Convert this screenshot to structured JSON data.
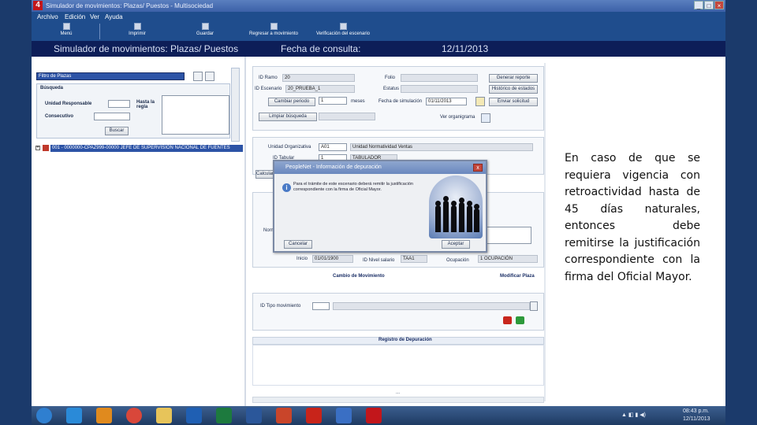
{
  "window": {
    "title": "Simulador de movimientos: Plazas/ Puestos - Multisociedad",
    "logo": "4"
  },
  "menu": [
    "Archivo",
    "Edición",
    "Ver",
    "Ayuda"
  ],
  "toolbar": [
    {
      "label": "Menú",
      "icon": "menu-icon"
    },
    {
      "label": "Imprimir",
      "icon": "print-icon"
    },
    {
      "label": "Guardar",
      "icon": "save-icon"
    },
    {
      "label": "Regresar a movimiento",
      "icon": "back-icon"
    },
    {
      "label": "Verificación del escenario",
      "icon": "check-icon"
    }
  ],
  "header": {
    "title": "Simulador de movimientos: Plazas/ Puestos",
    "date_label": "Fecha de consulta:",
    "date_value": "12/11/2013"
  },
  "left": {
    "search_value": "Filtro de Plazas",
    "group_title": "Búsqueda",
    "unit_label": "Unidad Responsable",
    "consec_label": "Consecutivo",
    "hasta_label": "Hasta la regla",
    "search_button": "Buscar",
    "tree_row": "001 - 0000000-CPAZ999-00000 JEFE DE SUPERVISION NACIONAL DE FUENTES"
  },
  "form": {
    "id_ramo_label": "ID Ramo",
    "id_ramo_value": "20",
    "folio_label": "Folio",
    "id_escenario_label": "ID Escenario",
    "id_escenario_value": "20_PRUEBA_1",
    "estatus_label": "Estatus",
    "generar_reporte": "Generar reporte",
    "historico_estados": "Histórico de estados",
    "cambiar_periodo": "Cambiar periodo",
    "periodo_value": "1",
    "meses_label": "meses",
    "fecha_simulacion_label": "Fecha de simulación",
    "fecha_simulacion_value": "01/11/2013",
    "enviar_solicitud": "Enviar solicitud",
    "limpiar_busqueda": "Limpiar búsqueda",
    "ver_organigrama": "Ver organigrama",
    "unidad_org_label": "Unidad Organizativa",
    "unidad_org_value": "A01",
    "unidad_org_desc": "Unidad Normatividad Ventas",
    "id_tabular_label": "ID Tabular",
    "id_tabular_value": "1",
    "id_tabular_desc": "TABULADOR CENTRAL",
    "calc_label": "Calcular",
    "norma_label": "Norma",
    "inicio_label": "Inicio",
    "inicio_value": "01/01/1900",
    "id_nivel_label": "ID Nivel salario",
    "id_nivel_value": "TAA1",
    "ocupacion_label": "Ocupación",
    "ocupacion_value": "1 OCUPACIÓN",
    "cambio_mov": "Cambio de Movimiento",
    "modificar_plaza": "Modificar Plaza",
    "id_tipo_mov_label": "ID Tipo movimiento",
    "registro_depuracion": "Registro de Depuración",
    "ellipsis": "..."
  },
  "dialog": {
    "title": "PeopleNet - Información de depuración",
    "message": "Para el trámite de este escenario deberá remitir la justificación correspondiente con la firma de Oficial Mayor.",
    "cancel_button": "Cancelar",
    "accept_button": "Aceptar",
    "close": "x"
  },
  "caption": {
    "lines": [
      "En caso de que se",
      "requiera vigencia con",
      "retroactividad hasta de",
      "45 días naturales,",
      "entonces debe",
      "remitirse la justificación",
      "correspondiente con la",
      "firma del Oficial Mayor."
    ]
  },
  "taskbar": {
    "apps": [
      {
        "name": "start-icon",
        "color": "#2f7fd0"
      },
      {
        "name": "internet-explorer-icon",
        "color": "#2a8ad8"
      },
      {
        "name": "media-player-icon",
        "color": "#e08a1e"
      },
      {
        "name": "chrome-icon",
        "color": "#d9473a"
      },
      {
        "name": "folder-icon",
        "color": "#e7c45a"
      },
      {
        "name": "outlook-icon",
        "color": "#1f5fb3"
      },
      {
        "name": "excel-icon",
        "color": "#1d7a3e"
      },
      {
        "name": "word-icon",
        "color": "#2b579a"
      },
      {
        "name": "powerpoint-icon",
        "color": "#c9452a"
      },
      {
        "name": "acrobat-icon",
        "color": "#c8241a"
      },
      {
        "name": "visio-icon",
        "color": "#3a6fc4"
      },
      {
        "name": "peoplenet-icon",
        "color": "#c2161b"
      }
    ],
    "time": "08:43 p.m.",
    "date": "12/11/2013"
  }
}
